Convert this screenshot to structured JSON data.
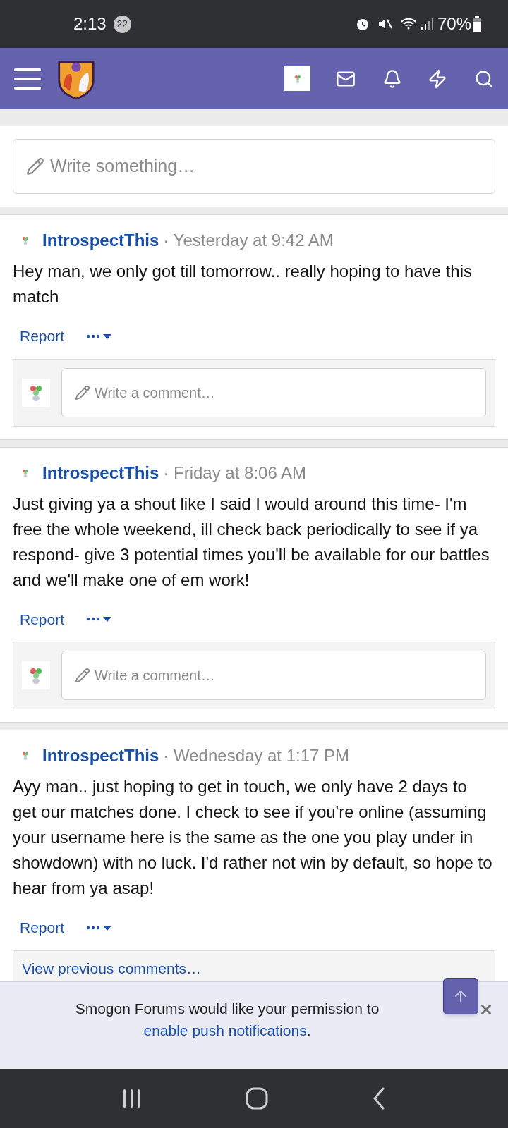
{
  "status_bar": {
    "time": "2:13",
    "notification_count": "22",
    "battery": "70%"
  },
  "composer": {
    "placeholder": "Write something…"
  },
  "posts": [
    {
      "author": "IntrospectThis",
      "time": "· Yesterday at 9:42 AM",
      "body": "Hey man, we only got till tomorrow.. really hoping to have this match",
      "actions": {
        "report": "Report"
      },
      "comment_placeholder": "Write a comment…"
    },
    {
      "author": "IntrospectThis",
      "time": "· Friday at 8:06 AM",
      "body": "Just giving ya a shout like I said I would around this time- I'm free the whole weekend, ill check back periodically to see if ya respond- give 3 potential times you'll be available for our battles and we'll make one of em work!",
      "actions": {
        "report": "Report"
      },
      "comment_placeholder": "Write a comment…"
    },
    {
      "author": "IntrospectThis",
      "time": "· Wednesday at 1:17 PM",
      "body": "Ayy man.. just hoping to get in touch, we only have 2 days to get our matches done. I check to see if you're online (assuming your username here is the same as the one you play under in showdown) with no luck. I'd rather not win by default, so hope to hear from ya asap!",
      "actions": {
        "report": "Report"
      },
      "view_previous": "View previous comments…"
    }
  ],
  "push_notice": {
    "text": "Smogon Forums would like your permission to",
    "link": "enable push notifications",
    "end": "."
  }
}
